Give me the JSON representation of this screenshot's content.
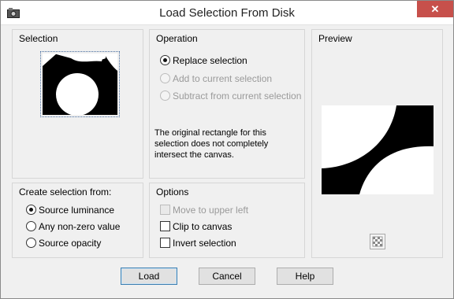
{
  "window": {
    "title": "Load Selection From Disk",
    "close_glyph": "✕"
  },
  "selection": {
    "label": "Selection"
  },
  "operation": {
    "label": "Operation",
    "options": [
      {
        "label": "Replace selection",
        "checked": true,
        "enabled": true
      },
      {
        "label": "Add to current selection",
        "checked": false,
        "enabled": false
      },
      {
        "label": "Subtract from current selection",
        "checked": false,
        "enabled": false
      }
    ],
    "note": "The original rectangle for this selection does not completely intersect the canvas."
  },
  "preview": {
    "label": "Preview"
  },
  "create_from": {
    "label": "Create selection from:",
    "options": [
      {
        "label": "Source luminance",
        "checked": true
      },
      {
        "label": "Any non-zero value",
        "checked": false
      },
      {
        "label": "Source opacity",
        "checked": false
      }
    ]
  },
  "options": {
    "label": "Options",
    "items": [
      {
        "label": "Move to upper left",
        "checked": false,
        "enabled": false
      },
      {
        "label": "Clip to canvas",
        "checked": false,
        "enabled": true
      },
      {
        "label": "Invert selection",
        "checked": false,
        "enabled": true
      }
    ]
  },
  "buttons": {
    "load": "Load",
    "cancel": "Cancel",
    "help": "Help"
  }
}
